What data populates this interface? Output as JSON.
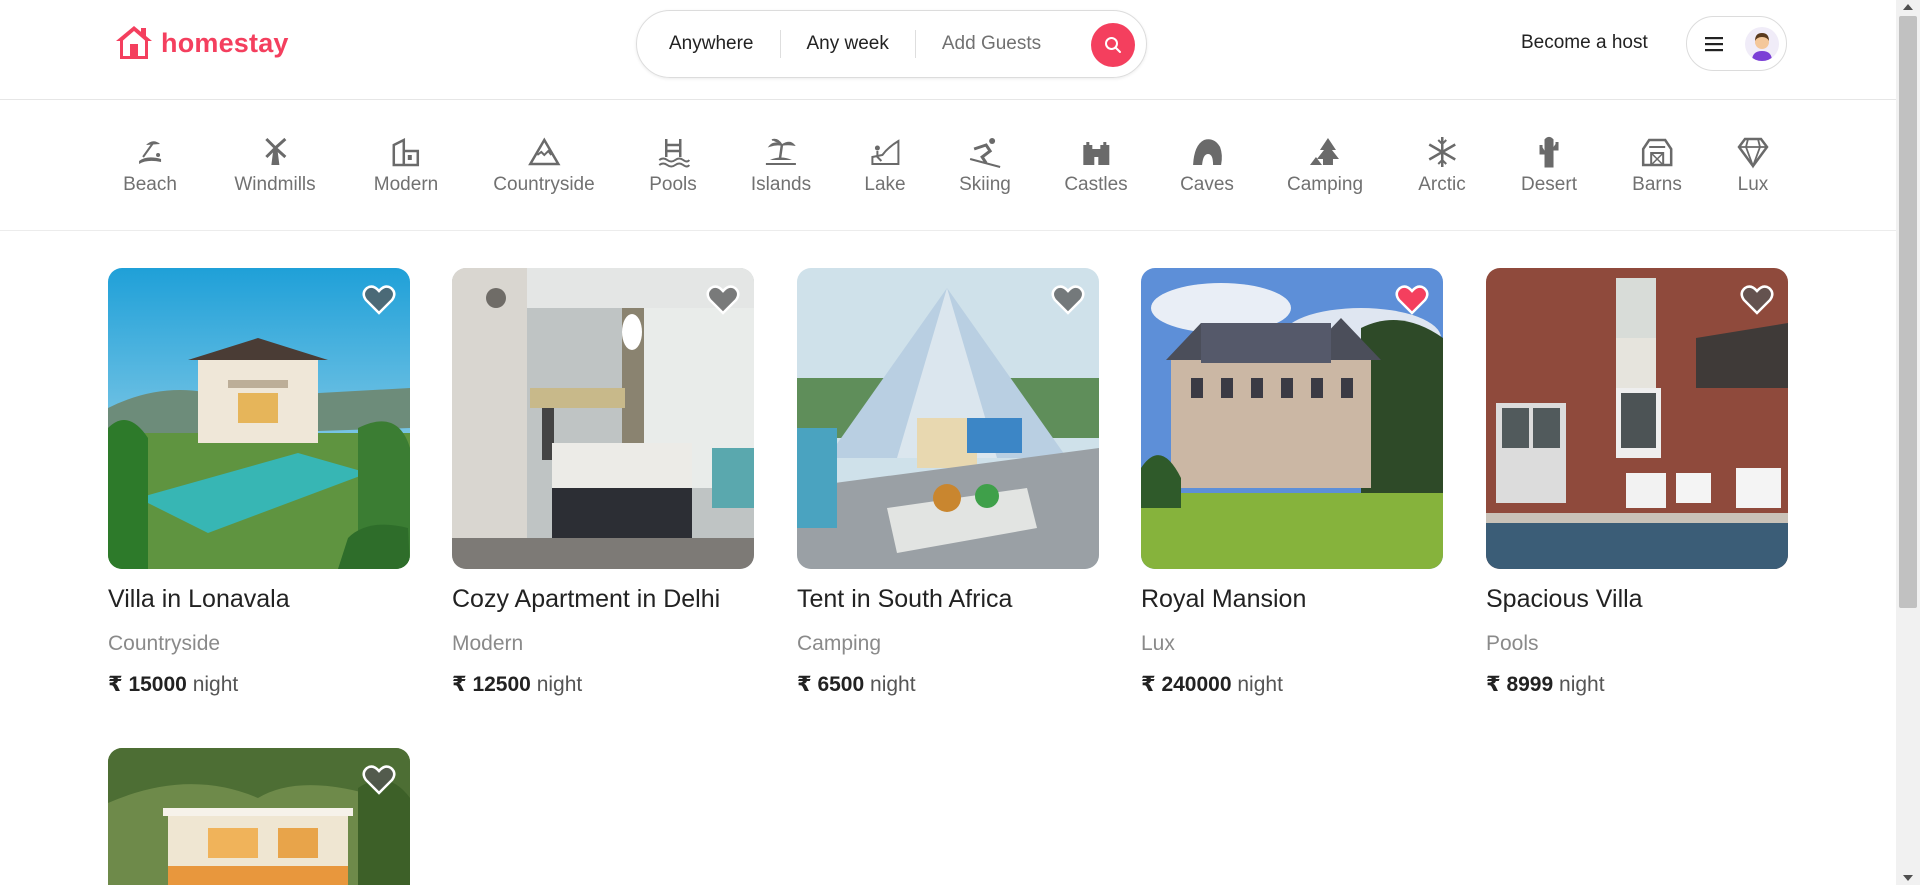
{
  "brand": {
    "name": "homestay",
    "color": "#f43f5e"
  },
  "search": {
    "where": "Anywhere",
    "when": "Any week",
    "who": "Add Guests"
  },
  "nav": {
    "host_label": "Become a host",
    "menu_icon": "hamburger-icon",
    "avatar_icon": "avatar"
  },
  "categories": [
    {
      "label": "Beach",
      "icon": "beach-icon"
    },
    {
      "label": "Windmills",
      "icon": "windmill-icon"
    },
    {
      "label": "Modern",
      "icon": "modern-building-icon"
    },
    {
      "label": "Countryside",
      "icon": "mountain-icon"
    },
    {
      "label": "Pools",
      "icon": "pool-icon"
    },
    {
      "label": "Islands",
      "icon": "island-icon"
    },
    {
      "label": "Lake",
      "icon": "lake-icon"
    },
    {
      "label": "Skiing",
      "icon": "skiing-icon"
    },
    {
      "label": "Castles",
      "icon": "castle-icon"
    },
    {
      "label": "Caves",
      "icon": "cave-icon"
    },
    {
      "label": "Camping",
      "icon": "camping-icon"
    },
    {
      "label": "Arctic",
      "icon": "snowflake-icon"
    },
    {
      "label": "Desert",
      "icon": "cactus-icon"
    },
    {
      "label": "Barns",
      "icon": "barn-icon"
    },
    {
      "label": "Lux",
      "icon": "diamond-icon"
    }
  ],
  "listings": [
    {
      "title": "Villa in Lonavala",
      "category": "Countryside",
      "price": "₹ 15000",
      "unit": "night",
      "favorited": false
    },
    {
      "title": "Cozy Apartment in Delhi",
      "category": "Modern",
      "price": "₹ 12500",
      "unit": "night",
      "favorited": false
    },
    {
      "title": "Tent in South Africa",
      "category": "Camping",
      "price": "₹ 6500",
      "unit": "night",
      "favorited": false
    },
    {
      "title": "Royal Mansion",
      "category": "Lux",
      "price": "₹ 240000",
      "unit": "night",
      "favorited": true
    },
    {
      "title": "Spacious Villa",
      "category": "Pools",
      "price": "₹ 8999",
      "unit": "night",
      "favorited": false
    },
    {
      "title": "",
      "category": "",
      "price": "",
      "unit": "",
      "favorited": false
    }
  ],
  "colors": {
    "heart_active": "#f43f5e",
    "heart_inactive": "#555555",
    "muted_text": "#717171"
  }
}
